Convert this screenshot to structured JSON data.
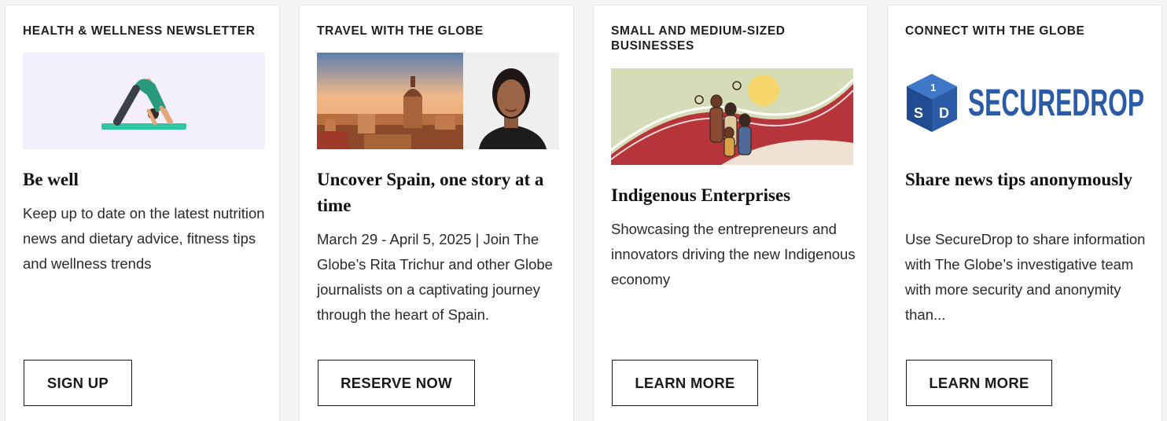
{
  "cards": [
    {
      "kicker": "HEALTH & WELLNESS NEWSLETTER",
      "title": "Be well",
      "description": "Keep up to date on the latest nutrition news and dietary advice, fitness tips and wellness trends",
      "button": "SIGN UP",
      "image": "yoga-illustration"
    },
    {
      "kicker": "TRAVEL WITH THE GLOBE",
      "title": "Uncover Spain, one story at a time",
      "description": "March 29 - April 5, 2025 | Join The Globe’s Rita Trichur and other Globe journalists on a captivating journey through the heart of Spain.",
      "button": "RESERVE NOW",
      "image": "spain-city-and-portrait"
    },
    {
      "kicker": "SMALL AND MEDIUM-SIZED BUSINESSES",
      "title": "Indigenous Enterprises",
      "description": "Showcasing the entrepreneurs and innovators driving the new Indigenous economy",
      "button": "LEARN MORE",
      "image": "indigenous-art-illustration"
    },
    {
      "kicker": "CONNECT WITH THE GLOBE",
      "title": "Share news tips anonymously",
      "description": "Use SecureDrop to share information with The Globe’s investigative team with more security and anonymity than...",
      "button": "LEARN MORE",
      "image": "securedrop-logo",
      "logo_text": "SECUREDROP"
    }
  ],
  "colors": {
    "securedrop_blue": "#2b5aa6",
    "yoga_mat": "#2fc7a3",
    "yoga_bg": "#f4effc"
  }
}
